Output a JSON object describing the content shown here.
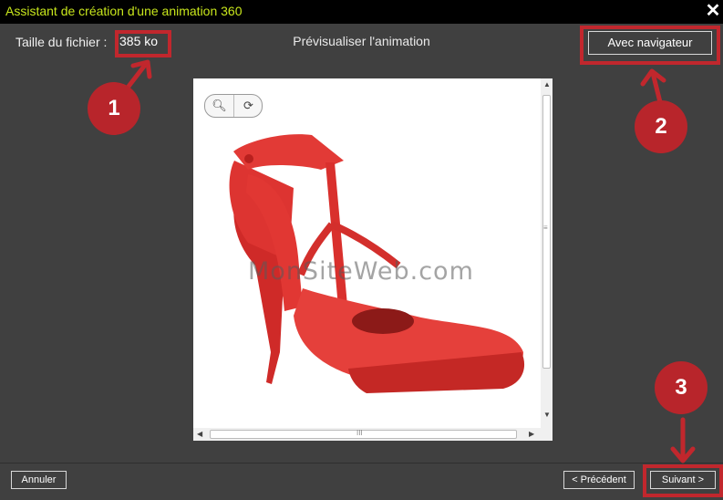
{
  "window": {
    "title": "Assistant de création d'une animation 360",
    "close_label": "✕"
  },
  "header": {
    "size_label": "Taille du fichier :",
    "size_value": "385 ko",
    "preview_title": "Prévisualiser l'animation",
    "browser_button": "Avec navigateur"
  },
  "viewer": {
    "watermark": "MonSiteWeb.com",
    "scroll_grip_v": "≡",
    "scroll_grip_h": "III",
    "image": "red-high-heel-shoe"
  },
  "footer": {
    "cancel": "Annuler",
    "previous": "< Précédent",
    "next": "Suivant >"
  },
  "annotations": {
    "markers": [
      "1",
      "2",
      "3"
    ],
    "color": "#c1272d"
  },
  "colors": {
    "window_bg": "#404040",
    "title_text": "#c8e61c",
    "shoe": "#e0312f"
  }
}
